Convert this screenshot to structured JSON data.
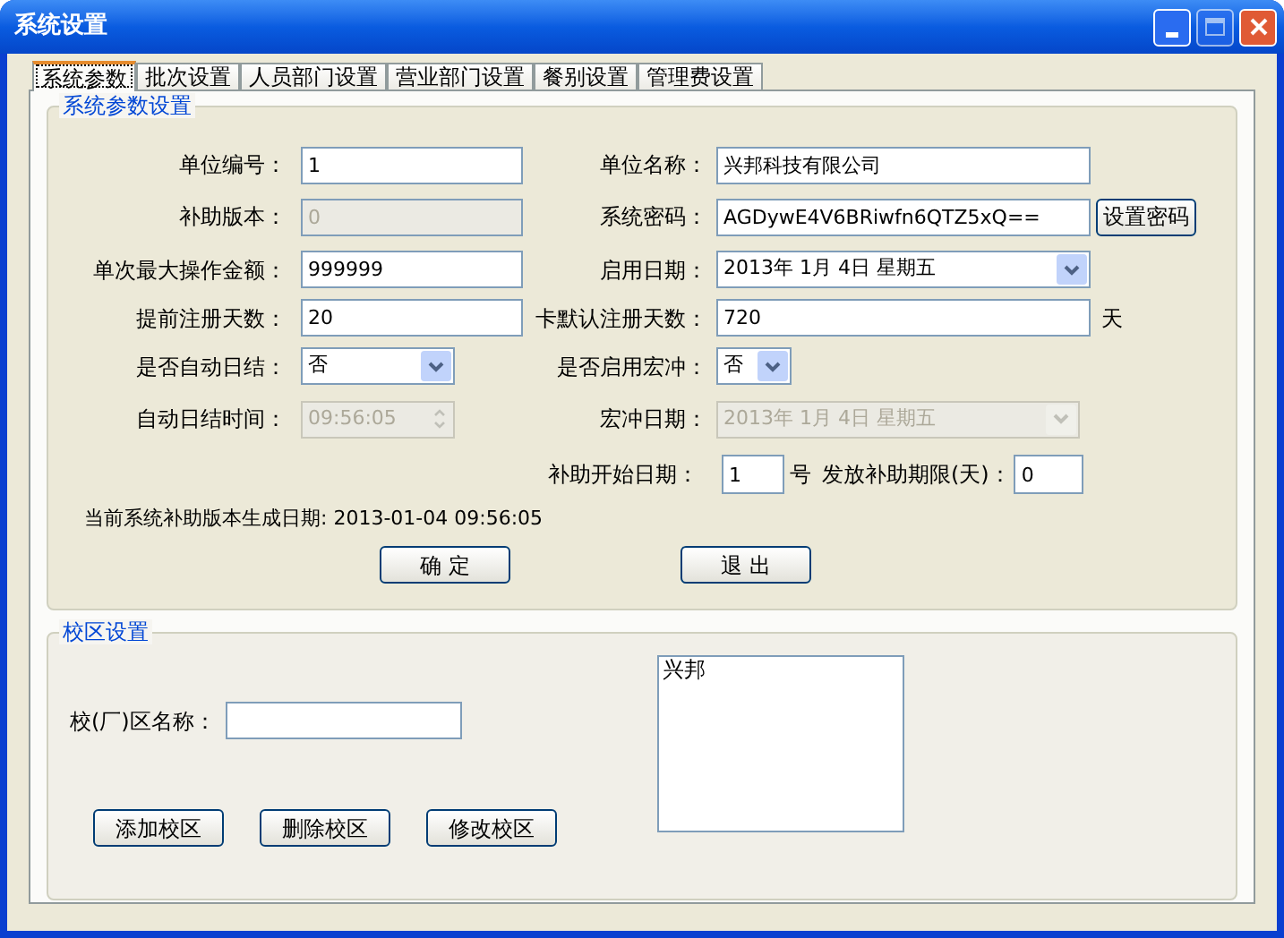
{
  "window": {
    "title": "系统设置"
  },
  "tabs": [
    {
      "label": "系统参数",
      "selected": true
    },
    {
      "label": "批次设置",
      "selected": false
    },
    {
      "label": "人员部门设置",
      "selected": false
    },
    {
      "label": "营业部门设置",
      "selected": false
    },
    {
      "label": "餐别设置",
      "selected": false
    },
    {
      "label": "管理费设置",
      "selected": false
    }
  ],
  "params_group": {
    "title": "系统参数设置",
    "rows": [
      {
        "left": {
          "label": "单位编号：",
          "kind": "text",
          "value": "1",
          "disabled": false
        },
        "right": {
          "label": "单位名称：",
          "kind": "text",
          "value": "兴邦科技有限公司",
          "disabled": false
        }
      },
      {
        "left": {
          "label": "补助版本：",
          "kind": "text",
          "value": "0",
          "disabled": true
        },
        "right": {
          "label": "系统密码：",
          "kind": "text",
          "value": "AGDywE4V6BRiwfn6QTZ5xQ==",
          "disabled": false,
          "button": "设置密码"
        }
      },
      {
        "left": {
          "label": "单次最大操作金额：",
          "kind": "text",
          "value": "999999",
          "disabled": false
        },
        "right": {
          "label": "启用日期：",
          "kind": "combo",
          "value": "2013年  1月  4日  星期五",
          "disabled": false
        }
      },
      {
        "left": {
          "label": "提前注册天数：",
          "kind": "text",
          "value": "20",
          "disabled": false
        },
        "right": {
          "label": "卡默认注册天数：",
          "kind": "text",
          "value": "720",
          "disabled": false,
          "unit": "天"
        }
      },
      {
        "left": {
          "label": "是否自动日结：",
          "kind": "combo",
          "value": "否",
          "disabled": false
        },
        "right": {
          "label": "是否启用宏冲：",
          "kind": "combo",
          "value": "否",
          "disabled": false
        }
      },
      {
        "left": {
          "label": "自动日结时间：",
          "kind": "spin",
          "value": "09:56:05",
          "disabled": true
        },
        "right": {
          "label": "宏冲日期：",
          "kind": "combo",
          "value": "2013年  1月  4日  星期五",
          "disabled": true
        }
      }
    ],
    "subsidy": {
      "label": "补助开始日期：",
      "value": "1",
      "unit": "号",
      "limit_label": "发放补助期限(天)：",
      "limit_value": "0"
    },
    "version_note": "当前系统补助版本生成日期: 2013-01-04 09:56:05",
    "buttons": [
      "确 定",
      "退 出"
    ]
  },
  "campus_group": {
    "title": "校区设置",
    "name_label": "校(厂)区名称：",
    "list": [
      "兴邦"
    ],
    "buttons": [
      "添加校区",
      "删除校区",
      "修改校区"
    ]
  }
}
